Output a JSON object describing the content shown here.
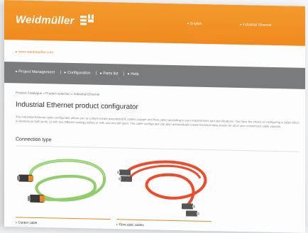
{
  "header": {
    "brand": "Weidmüller",
    "links": [
      "English",
      "Industrial Ethernet"
    ]
  },
  "site_url": "www.weidmueller.com",
  "nav": {
    "items": [
      "Project Management",
      "|",
      "Configuration",
      "|",
      "Parts list",
      "|",
      "Help"
    ]
  },
  "breadcrumb": "Product Catalogue » Product selection » Industrial Ethernet",
  "title": "Industrial Ethernet product configurator",
  "intro": "The Industrial Ethernet cable configurator allows you to custom create assembled IE cables (copper and fibre optic) according to your requirements and specifications. You have the choice of configuring a cable which is identical on both ends, or with two different mating profiles or with one end left open. The cable configurator can also automatically create technical data sheets for all of your customised cable variants.",
  "section": {
    "title": "Connection type"
  },
  "products": [
    {
      "label": "Copper cable",
      "cable_color": "#8fce6a"
    },
    {
      "label": "Fibre optic cables",
      "cable_color": "#ef4a2a"
    }
  ],
  "colors": {
    "brand_orange": "#ef8a1f",
    "nav_gray": "#7a7b7d"
  }
}
